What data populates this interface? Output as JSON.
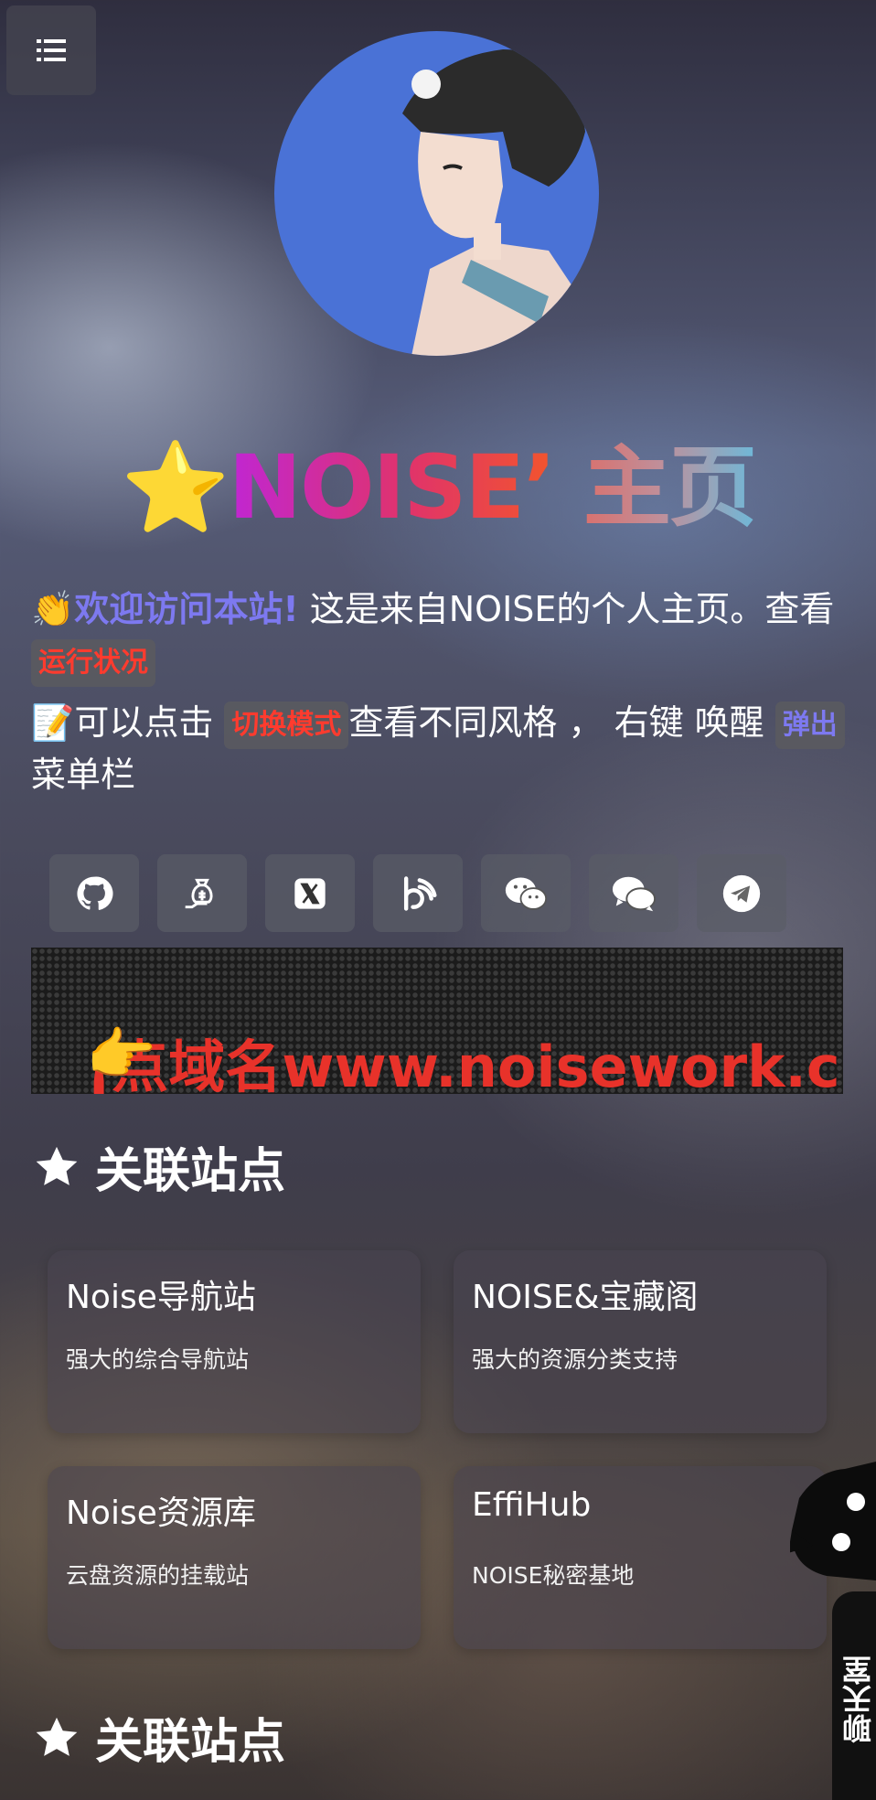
{
  "title": {
    "brand": "NOISE’",
    "page": "主页"
  },
  "intro": {
    "line1_highlight": "欢迎访问本站!",
    "line1_text": " 这是来自NOISE的个人主页。查看 ",
    "line1_pill": "运行状况",
    "line2_prefix": "可以点击 ",
    "line2_pill1": "切换模式",
    "line2_mid": "查看不同风格 ， 右键 唤醒 ",
    "line2_pill2": "弹出",
    "line2_suffix": " 菜单栏"
  },
  "socials": [
    "github-icon",
    "money-bag-icon",
    "x-icon",
    "bilibili-icon",
    "wechat-icon",
    "chat-bubbles-icon",
    "telegram-icon"
  ],
  "marquee": {
    "text": "¡点域名www.noisework.cn"
  },
  "sections": [
    {
      "title": "关联站点"
    },
    {
      "title": "关联站点"
    }
  ],
  "cards": [
    {
      "title": "Noise导航站",
      "desc": "强大的综合导航站"
    },
    {
      "title": "NOISE&宝藏阁",
      "desc": "强大的资源分类支持"
    },
    {
      "title": "Noise资源库",
      "desc": "云盘资源的挂载站"
    },
    {
      "title": "EffiHub",
      "desc": "NOISE秘密基地"
    }
  ],
  "chat": {
    "label": "聊天室"
  },
  "colors": {
    "brand_gradient_start": "#c026d3",
    "brand_gradient_end": "#f2552c",
    "highlight": "#7d79f0",
    "pill_text": "#ff3b2e"
  }
}
